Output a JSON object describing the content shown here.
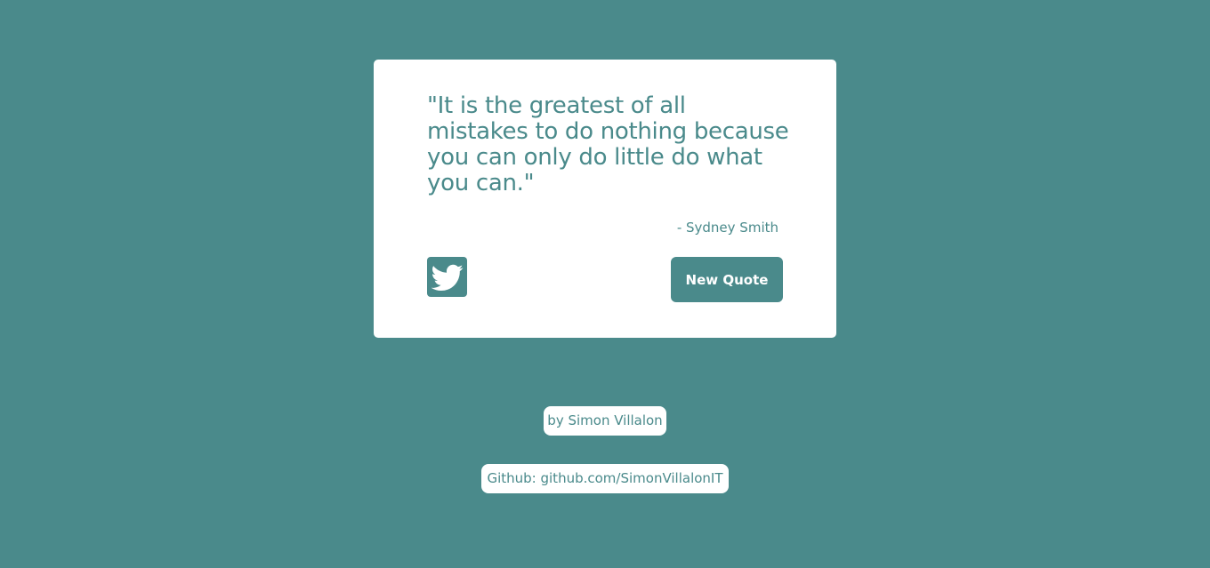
{
  "quote": {
    "text": "\"It is the greatest of all mistakes to do nothing because you can only do little do what you can.\"",
    "author": "- Sydney Smith"
  },
  "actions": {
    "tweet_icon": "twitter-icon",
    "new_quote_label": "New Quote"
  },
  "footer": {
    "credit": "by Simon Villalon",
    "github": "Github: github.com/SimonVillalonIT"
  },
  "colors": {
    "background": "#4a8a8b",
    "card": "#ffffff",
    "accent": "#4a8a8b"
  }
}
